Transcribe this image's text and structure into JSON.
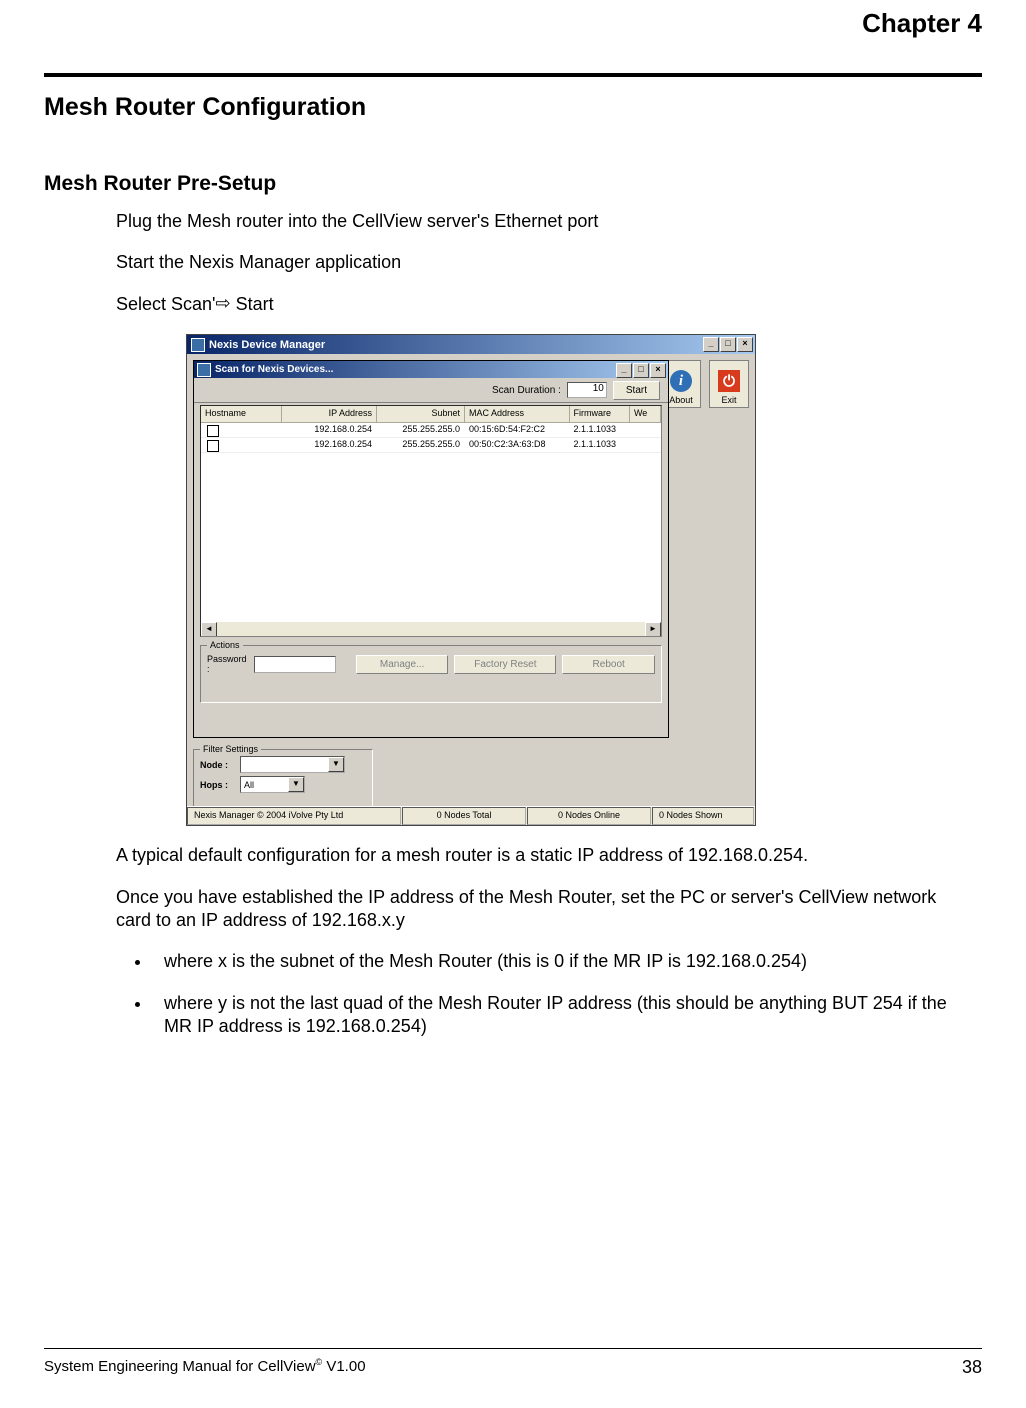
{
  "chapter": "Chapter 4",
  "title": "Mesh Router Configuration",
  "section": "Mesh Router Pre-Setup",
  "paras": {
    "p1": "Plug the Mesh router into the CellView server's Ethernet port",
    "p2": "Start the Nexis Manager application",
    "p3a": "Select Scan'",
    "p3b": " Start",
    "p4": "A typical default configuration for a mesh router is a static IP address of 192.168.0.254.",
    "p5": "Once you have established the IP address of the Mesh Router, set the PC or server's CellView network card to an IP address of 192.168.x.y",
    "b1": "where x is the subnet of the Mesh Router (this is 0 if the MR IP is 192.168.0.254)",
    "b2": "where y is not the last quad of the Mesh Router IP address (this should be anything BUT 254 if the MR IP address is 192.168.0.254)"
  },
  "window": {
    "outer_title": "Nexis Device Manager",
    "inner_title": "Scan for Nexis Devices...",
    "scan_label": "Scan Duration :",
    "scan_value": "10",
    "start_btn": "Start",
    "about_btn": "About",
    "exit_btn": "Exit",
    "cols": {
      "host": "Hostname",
      "ip": "IP Address",
      "sub": "Subnet",
      "mac": "MAC Address",
      "fw": "Firmware",
      "we": "We"
    },
    "rows": [
      {
        "ip": "192.168.0.254",
        "sub": "255.255.255.0",
        "mac": "00:15:6D:54:F2:C2",
        "fw": "2.1.1.1033"
      },
      {
        "ip": "192.168.0.254",
        "sub": "255.255.255.0",
        "mac": "00:50:C2:3A:63:D8",
        "fw": "2.1.1.1033"
      }
    ],
    "actions": {
      "legend": "Actions",
      "password_label": "Password :",
      "manage": "Manage...",
      "reset": "Factory Reset",
      "reboot": "Reboot"
    },
    "filter": {
      "legend": "Filter Settings",
      "node_label": "Node :",
      "hops_label": "Hops :",
      "hops_value": "All"
    },
    "status": {
      "copyright": "Nexis Manager © 2004 iVolve Pty Ltd",
      "nodes_total": "0 Nodes Total",
      "nodes_online": "0 Nodes Online",
      "nodes_shown": "0 Nodes Shown"
    }
  },
  "footer": {
    "left_a": "System Engineering Manual for CellView",
    "left_b": " V1.00",
    "page": "38"
  }
}
